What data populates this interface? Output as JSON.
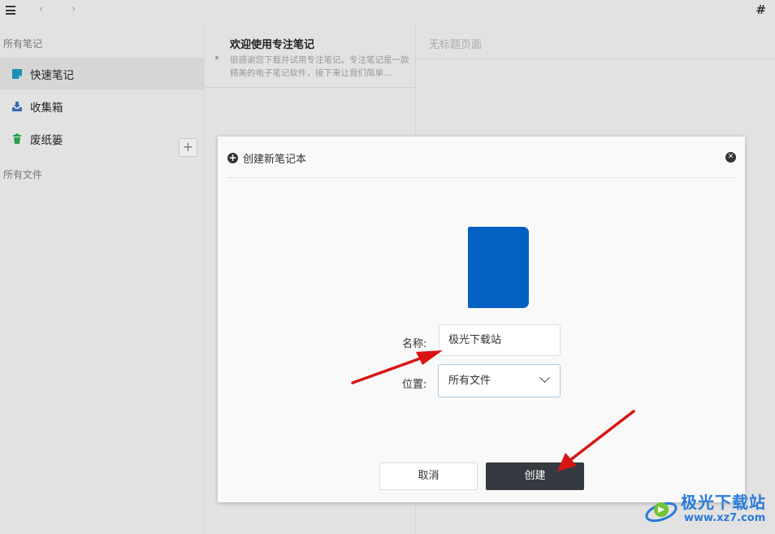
{
  "topbar": {
    "back_arrow": "‹",
    "forward_arrow": "›",
    "hash": "#"
  },
  "sidebar": {
    "all_notes_label": "所有笔记",
    "items": [
      {
        "label": "快速笔记",
        "icon": "quick-note-icon",
        "color": "#1e8fb3",
        "active": true
      },
      {
        "label": "收集箱",
        "icon": "inbox-icon",
        "color": "#3a6bb0",
        "active": false
      },
      {
        "label": "废纸篓",
        "icon": "trash-icon",
        "color": "#27a04a",
        "active": false
      }
    ],
    "all_files_label": "所有文件",
    "add_button": "+"
  },
  "notelist": {
    "note": {
      "title": "欢迎使用专注笔记",
      "snippet": "很感谢您下载并试用专注笔记。专注笔记是一款精美的电子笔记软件，接下来让我们简单…"
    }
  },
  "editor": {
    "title": "无标题页面"
  },
  "dialog": {
    "title": "创建新笔记本",
    "name_label": "名称:",
    "name_value": "极光下载站",
    "location_label": "位置:",
    "location_value": "所有文件",
    "cancel_label": "取消",
    "create_label": "创建",
    "notebook_color": "#0560c4"
  },
  "watermark": {
    "title": "极光下载站",
    "url": "www.xz7.com"
  }
}
